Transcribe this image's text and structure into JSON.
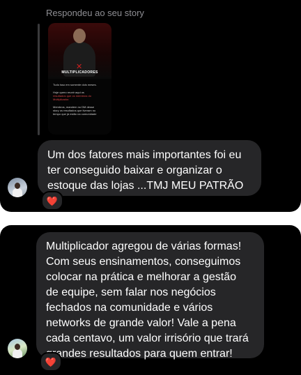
{
  "thread1": {
    "reply_label": "Respondeu ao seu story",
    "story_preview": {
      "brand_text": "MULTIPLICADORES",
      "lines": [
        "Tudo isso em somente dois meses.",
        "Hoje quero reunir aqui os",
        "resultados que os membros do",
        "Multiplicador.",
        "Membros, mandem no DM desse",
        "story os resultados que tiveram no",
        "tempo que já estão na comunidade"
      ],
      "emoji": "👇"
    },
    "message_lines": [
      "Um dos fatores mais importantes foi eu",
      "ter conseguido baixar e organizar o",
      "estoque das lojas ...TMJ MEU PATRÃO"
    ],
    "reaction": "❤️"
  },
  "thread2": {
    "message_lines": [
      "Multiplicador agregou de várias formas!",
      "Com seus ensinamentos, conseguimos",
      "colocar na prática e melhorar a gestão",
      "de equipe, sem falar nos negócios",
      "fechados na comunidade e vários",
      "networks de grande valor! Vale a pena",
      "cada centavo, um valor irrisório que trará",
      "grandes resultados para quem entrar!"
    ],
    "reaction": "❤️"
  }
}
